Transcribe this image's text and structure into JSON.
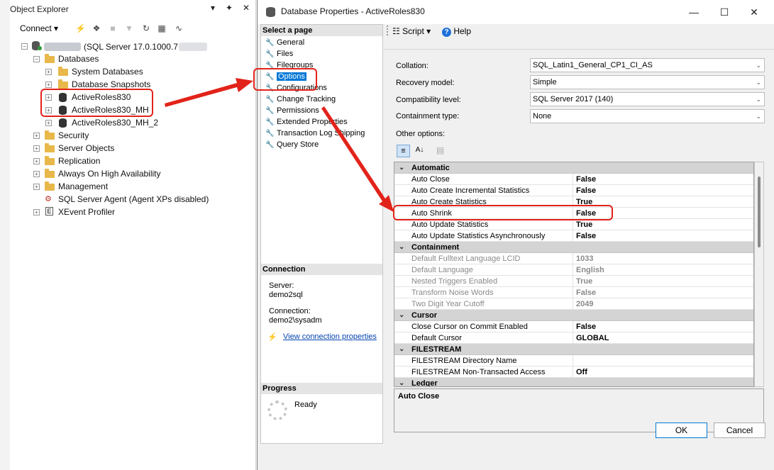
{
  "object_explorer": {
    "title": "Object Explorer",
    "pin": "↓",
    "pushpin": "✦",
    "close": "✕",
    "connect_label": "Connect",
    "tree": [
      {
        "label": "(SQL Server 17.0.1000.7 -",
        "exp": "−"
      },
      {
        "label": "Databases",
        "exp": "−"
      },
      {
        "label": "System Databases",
        "exp": "+"
      },
      {
        "label": "Database Snapshots",
        "exp": "+"
      },
      {
        "label": "ActiveRoles830",
        "exp": "+"
      },
      {
        "label": "ActiveRoles830_MH",
        "exp": "+"
      },
      {
        "label": "ActiveRoles830_MH_2",
        "exp": "+"
      },
      {
        "label": "Security",
        "exp": "+"
      },
      {
        "label": "Server Objects",
        "exp": "+"
      },
      {
        "label": "Replication",
        "exp": "+"
      },
      {
        "label": "Always On High Availability",
        "exp": "+"
      },
      {
        "label": "Management",
        "exp": "+"
      },
      {
        "label": "SQL Server Agent (Agent XPs disabled)",
        "exp": ""
      },
      {
        "label": "XEvent Profiler",
        "exp": "+"
      }
    ]
  },
  "dialog": {
    "title": "Database Properties - ActiveRoles830",
    "min": "—",
    "max": "☐",
    "close": "✕",
    "select_page_header": "Select a page",
    "pages": [
      "General",
      "Files",
      "Filegroups",
      "Options",
      "Configurations",
      "Change Tracking",
      "Permissions",
      "Extended Properties",
      "Transaction Log Shipping",
      "Query Store"
    ],
    "selected_page": "Options",
    "connection_header": "Connection",
    "server_label": "Server:",
    "server_value": "demo2sql",
    "connection_label": "Connection:",
    "connection_value": "demo2\\sysadm",
    "view_conn_link": "View connection properties",
    "progress_header": "Progress",
    "progress_status": "Ready",
    "script_label": "Script",
    "help_label": "Help",
    "collation_label": "Collation:",
    "collation_value": "SQL_Latin1_General_CP1_CI_AS",
    "recovery_label": "Recovery model:",
    "recovery_value": "Simple",
    "compat_label": "Compatibility level:",
    "compat_value": "SQL Server 2017 (140)",
    "containment_label": "Containment type:",
    "containment_value": "None",
    "other_options_label": "Other options:",
    "grid_rows": [
      {
        "cat": true,
        "name": "Automatic"
      },
      {
        "name": "Auto Close",
        "value": "False"
      },
      {
        "name": "Auto Create Incremental Statistics",
        "value": "False"
      },
      {
        "name": "Auto Create Statistics",
        "value": "True"
      },
      {
        "name": "Auto Shrink",
        "value": "False"
      },
      {
        "name": "Auto Update Statistics",
        "value": "True"
      },
      {
        "name": "Auto Update Statistics Asynchronously",
        "value": "False"
      },
      {
        "cat": true,
        "name": "Containment"
      },
      {
        "name": "Default Fulltext Language LCID",
        "value": "1033",
        "gray": true
      },
      {
        "name": "Default Language",
        "value": "English",
        "gray": true
      },
      {
        "name": "Nested Triggers Enabled",
        "value": "True",
        "gray": true
      },
      {
        "name": "Transform Noise Words",
        "value": "False",
        "gray": true
      },
      {
        "name": "Two Digit Year Cutoff",
        "value": "2049",
        "gray": true
      },
      {
        "cat": true,
        "name": "Cursor"
      },
      {
        "name": "Close Cursor on Commit Enabled",
        "value": "False"
      },
      {
        "name": "Default Cursor",
        "value": "GLOBAL"
      },
      {
        "cat": true,
        "name": "FILESTREAM"
      },
      {
        "name": "FILESTREAM Directory Name",
        "value": ""
      },
      {
        "name": "FILESTREAM Non-Transacted Access",
        "value": "Off"
      },
      {
        "cat": true,
        "name": "Ledger"
      }
    ],
    "description_title": "Auto Close",
    "ok_label": "OK",
    "cancel_label": "Cancel"
  }
}
